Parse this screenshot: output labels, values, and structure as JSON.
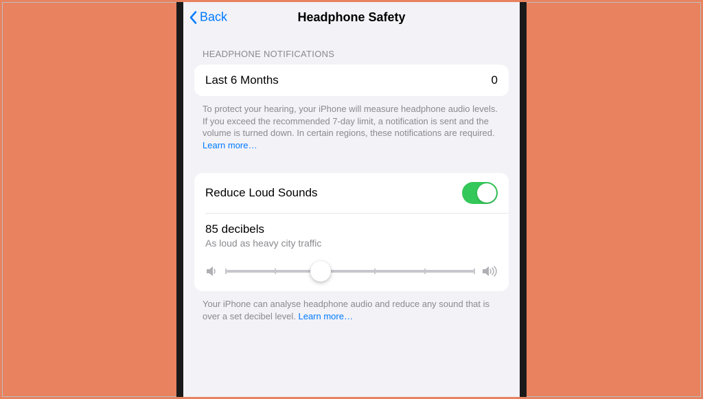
{
  "nav": {
    "back": "Back",
    "title": "Headphone Safety"
  },
  "notifications": {
    "header": "HEADPHONE NOTIFICATIONS",
    "row_label": "Last 6 Months",
    "row_value": "0",
    "footer": "To protect your hearing, your iPhone will measure headphone audio levels. If you exceed the recommended 7-day limit, a notification is sent and the volume is turned down. In certain regions, these notifications are required.",
    "learn_more": "Learn more…"
  },
  "reduce": {
    "label": "Reduce Loud Sounds",
    "toggle_on": true,
    "decibel_value": "85 decibels",
    "decibel_desc": "As loud as heavy city traffic",
    "slider_percent": 38,
    "footer": "Your iPhone can analyse headphone audio and reduce any sound that is over a set decibel level.",
    "learn_more": "Learn more…"
  }
}
